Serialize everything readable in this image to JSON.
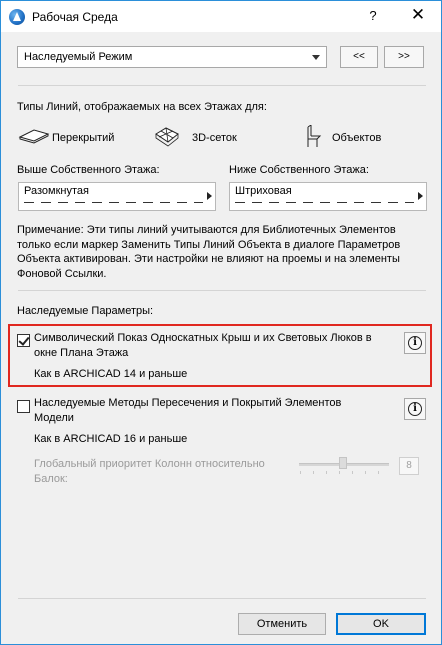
{
  "window": {
    "title": "Рабочая Среда",
    "help_label": "?",
    "close_label": "✕"
  },
  "mode": {
    "selected": "Наследуемый Режим",
    "prev_label": "<<",
    "next_label": ">>"
  },
  "line_types": {
    "heading": "Типы Линий, отображаемых на всех Этажах для:",
    "categories": [
      {
        "icon": "slab-icon",
        "label": "Перекрытий"
      },
      {
        "icon": "mesh-icon",
        "label": "3D-сеток"
      },
      {
        "icon": "chair-icon",
        "label": "Объектов"
      }
    ],
    "above_label": "Выше Собственного Этажа:",
    "above_value": "Разомкнутая",
    "below_label": "Ниже Собственного Этажа:",
    "below_value": "Штриховая",
    "note": "Примечание: Эти типы линий учитываются для Библиотечных Элементов только если маркер Заменить Типы Линий Объекта в диалоге Параметров Объекта активирован. Эти настройки не влияют на проемы и на элементы Фоновой Ссылки."
  },
  "inherited": {
    "heading": "Наследуемые Параметры:",
    "options": [
      {
        "label": "Символический Показ Односкатных Крыш и их Световых Люков в окне Плана Этажа",
        "checked": true,
        "sublabel": "Как в ARCHICAD 14 и раньше"
      },
      {
        "label": "Наследуемые Методы Пересечения и Покрытий Элементов Модели",
        "checked": false,
        "sublabel": "Как в ARCHICAD 16 и раньше"
      }
    ],
    "priority_label": "Глобальный приоритет Колонн относительно Балок:",
    "priority_value": "8"
  },
  "footer": {
    "cancel_label": "Отменить",
    "ok_label": "OK"
  },
  "colors": {
    "highlight": "#e0271f",
    "window_border": "#2b8fd9"
  }
}
